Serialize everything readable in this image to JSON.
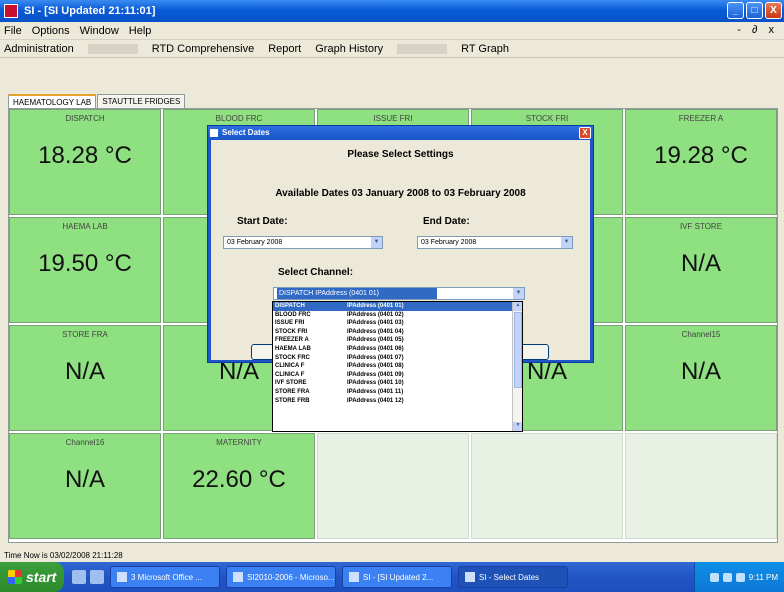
{
  "window": {
    "title": "SI - [SI Updated 21:11:01]",
    "minimize": "_",
    "maximize": "□",
    "close": "X"
  },
  "menu": {
    "items": [
      "File",
      "Options",
      "Window",
      "Help"
    ],
    "right": "- ∂ x"
  },
  "toolbar": {
    "items": [
      "Administration",
      "RTD Comprehensive",
      "Report",
      "Graph History",
      "RT Graph"
    ]
  },
  "tabs": [
    "HAEMATOLOGY LAB",
    "STAUTTLE FRIDGES"
  ],
  "tiles": [
    {
      "name": "DISPATCH",
      "value": "18.28 °C",
      "style": "green"
    },
    {
      "name": "BLOOD FRC",
      "value": "2",
      "style": "green"
    },
    {
      "name": "ISSUE FRI",
      "value": "",
      "style": "green"
    },
    {
      "name": "STOCK FRI",
      "value": "C",
      "style": "green"
    },
    {
      "name": "FREEZER A",
      "value": "19.28 °C",
      "style": "green"
    },
    {
      "name": "HAEMA LAB",
      "value": "19.50 °C",
      "style": "green"
    },
    {
      "name": "",
      "value": "",
      "style": "green"
    },
    {
      "name": "",
      "value": "",
      "style": "green"
    },
    {
      "name": "",
      "value": "",
      "style": "green"
    },
    {
      "name": "IVF STORE",
      "value": "N/A",
      "style": "green"
    },
    {
      "name": "STORE FRA",
      "value": "N/A",
      "style": "green"
    },
    {
      "name": "",
      "value": "N/A",
      "style": "green"
    },
    {
      "name": "",
      "value": "",
      "style": "green"
    },
    {
      "name": "",
      "value": "N/A",
      "style": "green"
    },
    {
      "name": "Channel15",
      "value": "N/A",
      "style": "green"
    },
    {
      "name": "Channel16",
      "value": "N/A",
      "style": "green"
    },
    {
      "name": "MATERNITY",
      "value": "22.60 °C",
      "style": "green"
    },
    {
      "name": "",
      "value": "",
      "style": "empty"
    },
    {
      "name": "",
      "value": "",
      "style": "empty"
    },
    {
      "name": "",
      "value": "",
      "style": "empty"
    }
  ],
  "statusbar": {
    "text": "Time Now is 03/02/2008 21:11:28"
  },
  "dialog": {
    "title": "Select Dates",
    "heading": "Please Select Settings",
    "available": "Available Dates 03 January 2008 to 03 February 2008",
    "start_label": "Start Date:",
    "start_value": "03 February 2008",
    "end_label": "End Date:",
    "end_value": "03 February 2008",
    "channel_label": "Select Channel:",
    "channel_value": "DISPATCH        IPAddress (0401 01)",
    "close": "X"
  },
  "channel_options": [
    {
      "name": "DISPATCH",
      "addr": "IPAddress (0401 01)"
    },
    {
      "name": "BLOOD FRC",
      "addr": "IPAddress (0401 02)"
    },
    {
      "name": "ISSUE FRI",
      "addr": "IPAddress (0401 03)"
    },
    {
      "name": "STOCK FRI",
      "addr": "IPAddress (0401 04)"
    },
    {
      "name": "FREEZER A",
      "addr": "IPAddress (0401 05)"
    },
    {
      "name": "HAEMA LAB",
      "addr": "IPAddress (0401 06)"
    },
    {
      "name": "STOCK FRC",
      "addr": "IPAddress (0401 07)"
    },
    {
      "name": "CLINICA F",
      "addr": "IPAddress (0401 08)"
    },
    {
      "name": "CLINICA F",
      "addr": "IPAddress (0401 09)"
    },
    {
      "name": "IVF STORE",
      "addr": "IPAddress (0401 10)"
    },
    {
      "name": "STORE FRA",
      "addr": "IPAddress (0401 11)"
    },
    {
      "name": "STORE FRB",
      "addr": "IPAddress (0401 12)"
    }
  ],
  "taskbar": {
    "start": "start",
    "buttons": [
      "3 Microsoft Office ...",
      "SI2010-2006 - Microso...",
      "SI - [SI Updated 2...",
      "SI - Select Dates"
    ],
    "clock": "9:11 PM"
  }
}
